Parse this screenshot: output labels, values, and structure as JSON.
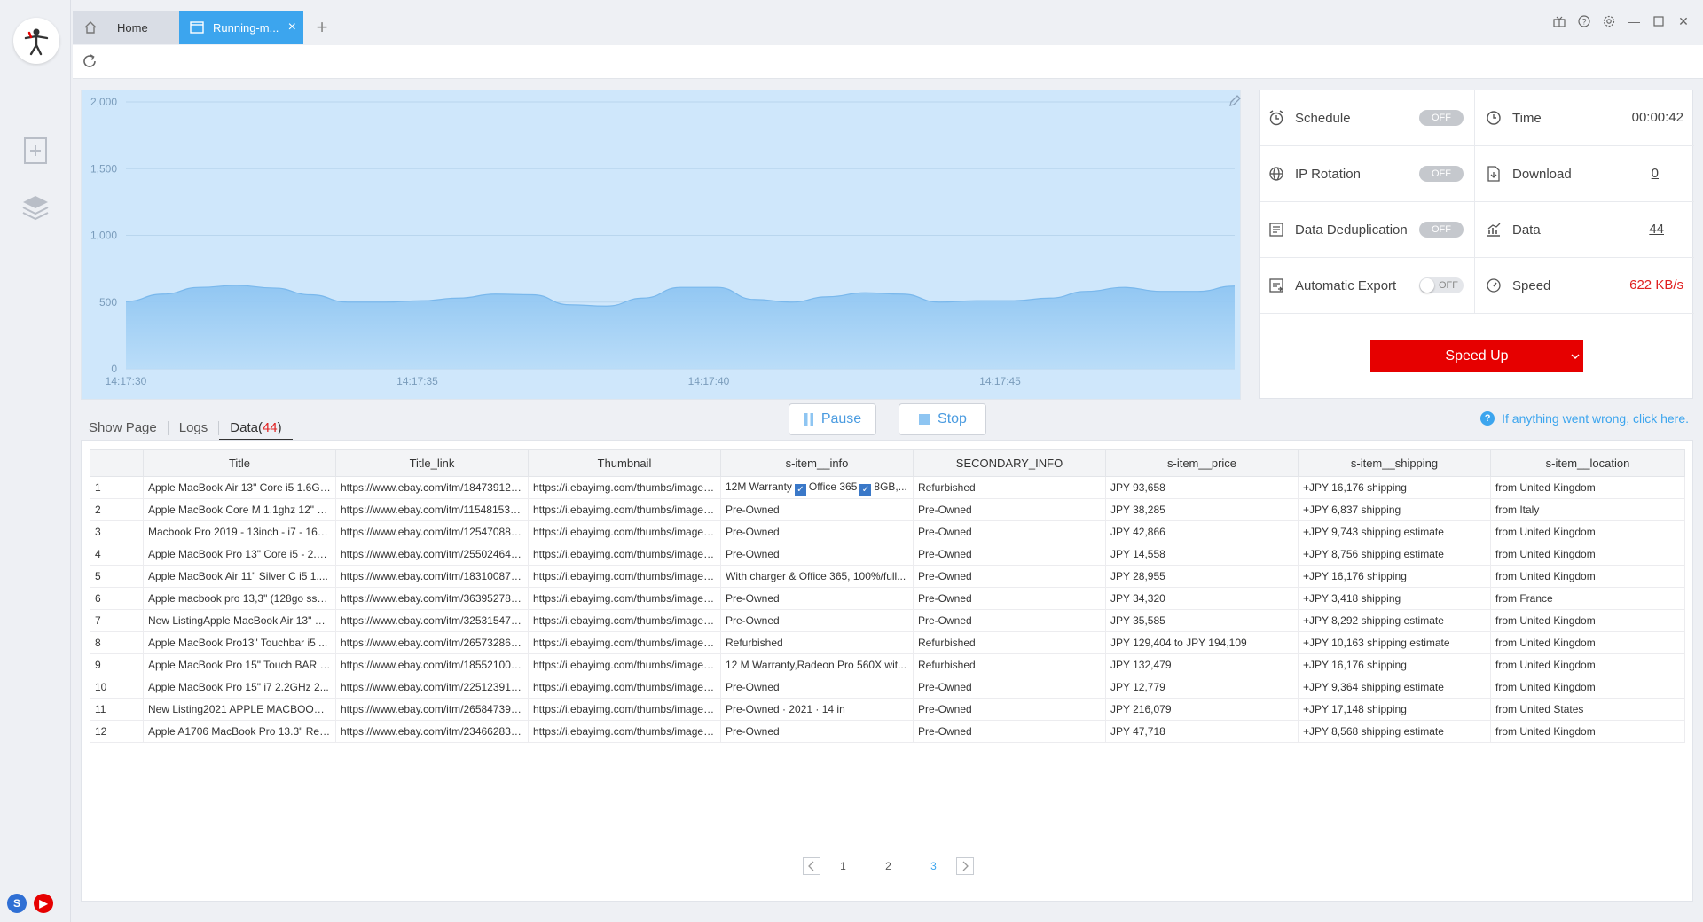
{
  "tabs": {
    "home_label": "Home",
    "running_label": "Running-m...",
    "add_label": "+"
  },
  "chart": {
    "y_ticks": [
      "2,000",
      "1,500",
      "1,000",
      "500",
      "0"
    ],
    "x_ticks": [
      "14:17:30",
      "14:17:35",
      "14:17:40",
      "14:17:45"
    ]
  },
  "chart_data": {
    "type": "area",
    "ylim": [
      0,
      2000
    ],
    "y_ticks": [
      0,
      500,
      1000,
      1500,
      2000
    ],
    "x_ticks": [
      "14:17:30",
      "14:17:35",
      "14:17:40",
      "14:17:45"
    ],
    "series": [
      {
        "values": [
          505,
          560,
          610,
          625,
          605,
          555,
          500,
          500,
          510,
          530,
          560,
          555,
          480,
          470,
          530,
          610,
          610,
          520,
          500,
          540,
          570,
          560,
          500,
          510,
          510,
          530,
          580,
          610,
          580,
          580,
          620
        ]
      }
    ],
    "grid": true
  },
  "status": {
    "schedule": {
      "label": "Schedule",
      "toggle": "OFF"
    },
    "ip_rotation": {
      "label": "IP Rotation",
      "toggle": "OFF"
    },
    "dedup": {
      "label": "Data Deduplication",
      "toggle": "OFF"
    },
    "auto_export": {
      "label": "Automatic Export",
      "toggle": "OFF"
    },
    "time": {
      "label": "Time",
      "value": "00:00:42"
    },
    "download": {
      "label": "Download",
      "value": "0"
    },
    "data": {
      "label": "Data",
      "value": "44"
    },
    "speed": {
      "label": "Speed",
      "value": "622 KB/s"
    },
    "speed_up_label": "Speed Up"
  },
  "subtabs": {
    "show_page": "Show Page",
    "logs": "Logs",
    "data_label": "Data(",
    "data_count": "44",
    "data_close": ")"
  },
  "controls": {
    "pause_label": "Pause",
    "stop_label": "Stop",
    "help_text": "If anything went wrong, click here."
  },
  "table": {
    "columns": [
      "",
      "Title",
      "Title_link",
      "Thumbnail",
      "s-item__info",
      "SECONDARY_INFO",
      "s-item__price",
      "s-item__shipping",
      "s-item__location"
    ],
    "rows": [
      [
        "1",
        "Apple MacBook Air 13\" Core i5 1.6GHz",
        "https://www.ebay.com/itm/184739126...",
        "https://i.ebayimg.com/thumbs/images...",
        "12M Warranty|Office 365|8GB,...",
        "Refurbished",
        "JPY 93,658",
        "+JPY 16,176 shipping",
        "from United Kingdom"
      ],
      [
        "2",
        "Apple MacBook Core M 1.1ghz 12\" 8...",
        "https://www.ebay.com/itm/115481532...",
        "https://i.ebayimg.com/thumbs/images...",
        "Pre-Owned",
        "Pre-Owned",
        "JPY 38,285",
        "+JPY 6,837 shipping",
        "from Italy"
      ],
      [
        "3",
        "Macbook Pro 2019 - 13inch - i7 - 16g...",
        "https://www.ebay.com/itm/125470887...",
        "https://i.ebayimg.com/thumbs/images...",
        "Pre-Owned",
        "Pre-Owned",
        "JPY 42,866",
        "+JPY 9,743 shipping estimate",
        "from United Kingdom"
      ],
      [
        "4",
        "Apple MacBook Pro 13\" Core i5 - 2.3...",
        "https://www.ebay.com/itm/255024649...",
        "https://i.ebayimg.com/thumbs/images...",
        "Pre-Owned",
        "Pre-Owned",
        "JPY 14,558",
        "+JPY 8,756 shipping estimate",
        "from United Kingdom"
      ],
      [
        "5",
        "Apple MacBook Air 11\" Silver C i5 1....",
        "https://www.ebay.com/itm/183100871...",
        "https://i.ebayimg.com/thumbs/images...",
        "With charger & Office 365, 100%/full...",
        "Pre-Owned",
        "JPY 28,955",
        "+JPY 16,176 shipping",
        "from United Kingdom"
      ],
      [
        "6",
        "Apple macbook pro 13,3\" (128go ssd...",
        "https://www.ebay.com/itm/363952783...",
        "https://i.ebayimg.com/thumbs/images...",
        "Pre-Owned",
        "Pre-Owned",
        "JPY 34,320",
        "+JPY 3,418 shipping",
        "from France"
      ],
      [
        "7",
        "New ListingApple MacBook Air 13\" C...",
        "https://www.ebay.com/itm/325315470...",
        "https://i.ebayimg.com/thumbs/images...",
        "Pre-Owned",
        "Pre-Owned",
        "JPY 35,585",
        "+JPY 8,292 shipping estimate",
        "from United Kingdom"
      ],
      [
        "8",
        "Apple MacBook Pro13\" Touchbar i5 ...",
        "https://www.ebay.com/itm/265732861...",
        "https://i.ebayimg.com/thumbs/images...",
        "Refurbished",
        "Refurbished",
        "JPY 129,404 to JPY 194,109",
        "+JPY 10,163 shipping estimate",
        "from United Kingdom"
      ],
      [
        "9",
        "Apple MacBook Pro 15\" Touch BAR i...",
        "https://www.ebay.com/itm/185521009...",
        "https://i.ebayimg.com/thumbs/images...",
        "12 M Warranty,Radeon Pro 560X wit...",
        "Refurbished",
        "JPY 132,479",
        "+JPY 16,176 shipping",
        "from United Kingdom"
      ],
      [
        "10",
        "Apple MacBook Pro 15\" i7 2.2GHz 2...",
        "https://www.ebay.com/itm/225123916...",
        "https://i.ebayimg.com/thumbs/images...",
        "Pre-Owned",
        "Pre-Owned",
        "JPY 12,779",
        "+JPY 9,364 shipping estimate",
        "from United Kingdom"
      ],
      [
        "11",
        "New Listing2021 APPLE MACBOOK ...",
        "https://www.ebay.com/itm/265847391...",
        "https://i.ebayimg.com/thumbs/images...",
        "Pre-Owned · 2021 · 14 in",
        "Pre-Owned",
        "JPY 216,079",
        "+JPY 17,148 shipping",
        "from United States"
      ],
      [
        "12",
        "Apple A1706 MacBook Pro 13.3\" Ret...",
        "https://www.ebay.com/itm/234662838...",
        "https://i.ebayimg.com/thumbs/images...",
        "Pre-Owned",
        "Pre-Owned",
        "JPY 47,718",
        "+JPY 8,568 shipping estimate",
        "from United Kingdom"
      ]
    ]
  },
  "pager": {
    "pages": [
      "1",
      "2",
      "3"
    ],
    "current": "3"
  },
  "colors": {
    "accent": "#3ca5ee",
    "speed_up": "#e60000",
    "speed_value": "#e02020",
    "chart_fill": "#8ec5f2",
    "chart_bg": "#cfe7fb"
  }
}
